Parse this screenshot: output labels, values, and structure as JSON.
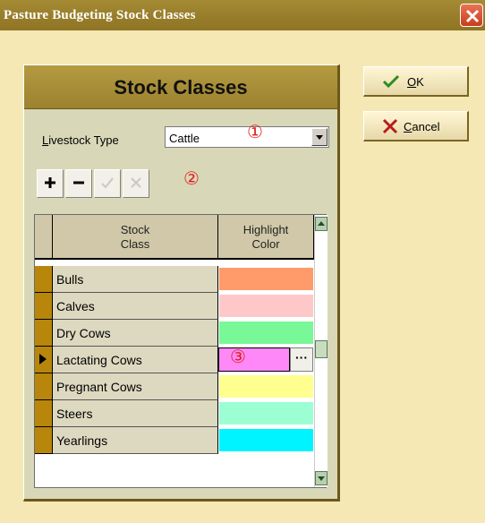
{
  "window": {
    "title": "Pasture Budgeting Stock Classes"
  },
  "panel": {
    "title": "Stock Classes"
  },
  "livestock": {
    "label_underline": "L",
    "label_rest": "ivestock Type",
    "value": "Cattle"
  },
  "annotations": {
    "one": "①",
    "two": "②",
    "three": "③"
  },
  "navigator": {
    "buttons": [
      {
        "icon": "plus-icon"
      },
      {
        "icon": "minus-icon"
      },
      {
        "icon": "check-icon"
      },
      {
        "icon": "x-icon"
      }
    ]
  },
  "grid": {
    "headers": {
      "stock_class_line1": "Stock",
      "stock_class_line2": "Class",
      "highlight_line1": "Highlight",
      "highlight_line2": "Color"
    },
    "rows": [
      {
        "name": "Bulls",
        "color": "#FF9B6A"
      },
      {
        "name": "Calves",
        "color": "#FFC8C8"
      },
      {
        "name": "Dry Cows",
        "color": "#78F896"
      },
      {
        "name": "Lactating Cows",
        "color": "#FF88F8",
        "selected": true,
        "ellipsis": "···"
      },
      {
        "name": "Pregnant Cows",
        "color": "#FFFF90"
      },
      {
        "name": "Steers",
        "color": "#9CFFD4"
      },
      {
        "name": "Yearlings",
        "color": "#00F4FF"
      }
    ]
  },
  "buttons": {
    "ok_underline": "O",
    "ok_rest": "K",
    "cancel_underline": "C",
    "cancel_rest": "ancel"
  },
  "colors": {
    "title_bar": "#9C8230",
    "dialog_bg": "#F6E8B4",
    "indicator": "#B8860B"
  }
}
